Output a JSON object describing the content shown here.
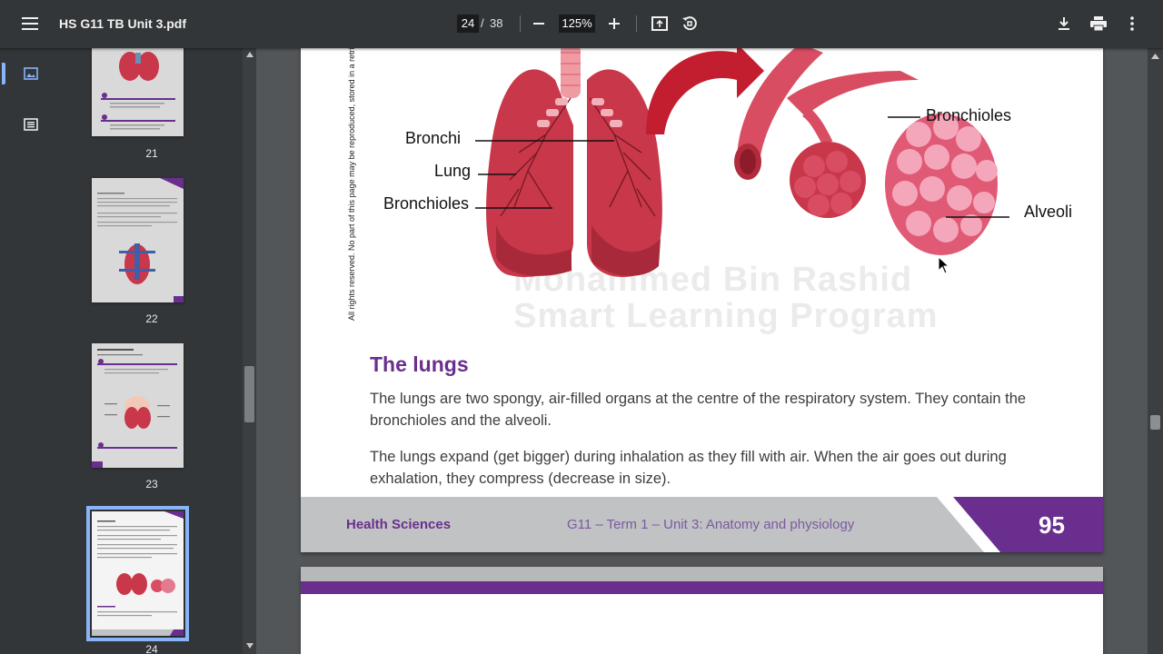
{
  "toolbar": {
    "file_title": "HS G11 TB Unit 3.pdf",
    "current_page": "24",
    "page_separator": "/",
    "total_pages": "38",
    "zoom": "125%",
    "icons": [
      "menu-icon",
      "zoom-out-icon",
      "zoom-in-icon",
      "fit-page-icon",
      "rotate-icon",
      "download-icon",
      "print-icon",
      "more-vert-icon"
    ]
  },
  "sidebar": {
    "thumbnails": [
      {
        "label": "21"
      },
      {
        "label": "22"
      },
      {
        "label": "23"
      },
      {
        "label": "24"
      }
    ]
  },
  "document": {
    "diagram_labels": {
      "bronchi": "Bronchi",
      "lung": "Lung",
      "bronchioles_left": "Bronchioles",
      "bronchioles_right": "Bronchioles",
      "alveoli": "Alveoli"
    },
    "vertical_note": "All rights reserved. No part of this page may be reproduced, stored in a retrieval",
    "watermark_line1": "Mohammed Bin Rashid",
    "watermark_line2": "Smart Learning Program",
    "section_title": "The lungs",
    "paragraphs": [
      "The lungs are two spongy, air-filled organs at the centre of the respiratory system. They contain the bronchioles and the alveoli.",
      "The lungs expand (get bigger) during inhalation as they fill with air. When the air goes out during exhalation, they compress (decrease in size)."
    ],
    "footer": {
      "subject": "Health Sciences",
      "unit": "G11 – Term 1 – Unit 3: Anatomy and physiology",
      "page_number": "95"
    }
  },
  "colors": {
    "toolbar_bg": "#323639",
    "accent_purple": "#6a2f8e",
    "lung_red": "#c9374a",
    "selection_blue": "#8ab4f8"
  }
}
